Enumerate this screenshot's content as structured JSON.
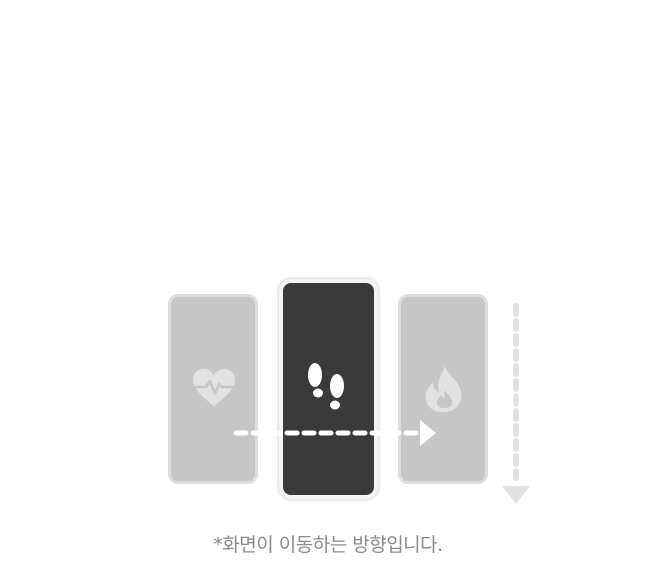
{
  "caption": "*화면이 이동하는 방향입니다.",
  "icons": {
    "left": "heart-rate-icon",
    "center": "footsteps-icon",
    "right": "flame-icon"
  },
  "colors": {
    "side_card": "#c6c6c6",
    "center_card": "#3a3a3a",
    "caption_text": "#8a8a8a"
  }
}
